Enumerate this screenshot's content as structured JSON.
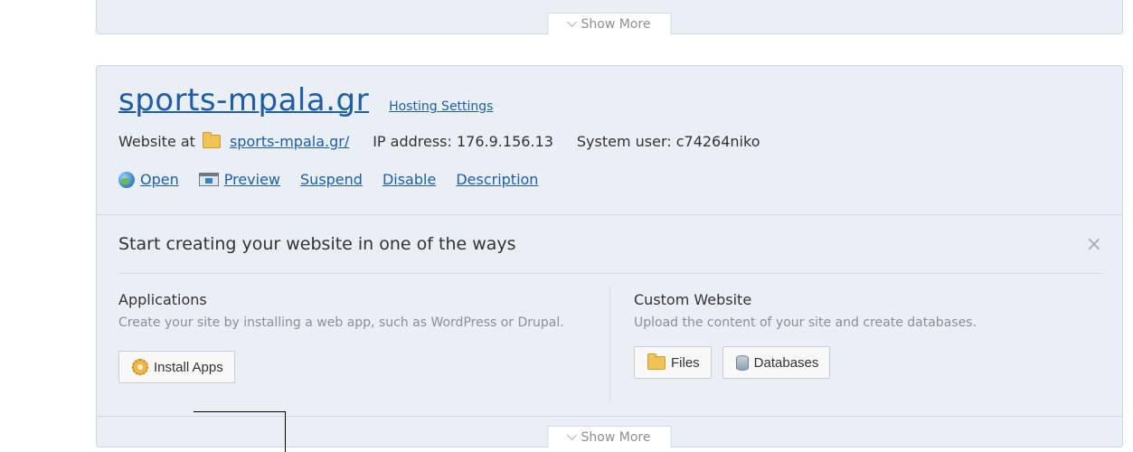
{
  "top_section": {
    "show_more_label": "Show More"
  },
  "domain": {
    "name": "sports-mpala.gr",
    "hosting_settings_label": "Hosting Settings",
    "website_at_label": "Website at",
    "website_path": "sports-mpala.gr/",
    "ip_label": "IP address: 176.9.156.13",
    "system_user_label": "System user: c74264niko",
    "actions": {
      "open": "Open",
      "preview": "Preview",
      "suspend": "Suspend",
      "disable": "Disable",
      "description": "Description"
    }
  },
  "start_creating": {
    "title": "Start creating your website in one of the ways",
    "close_label": "×",
    "applications": {
      "title": "Applications",
      "description": "Create your site by installing a web app, such as WordPress or Drupal.",
      "install_button": "Install Apps"
    },
    "custom_website": {
      "title": "Custom Website",
      "description": "Upload the content of your site and create databases.",
      "files_button": "Files",
      "databases_button": "Databases"
    }
  },
  "bottom_show_more_label": "Show More"
}
